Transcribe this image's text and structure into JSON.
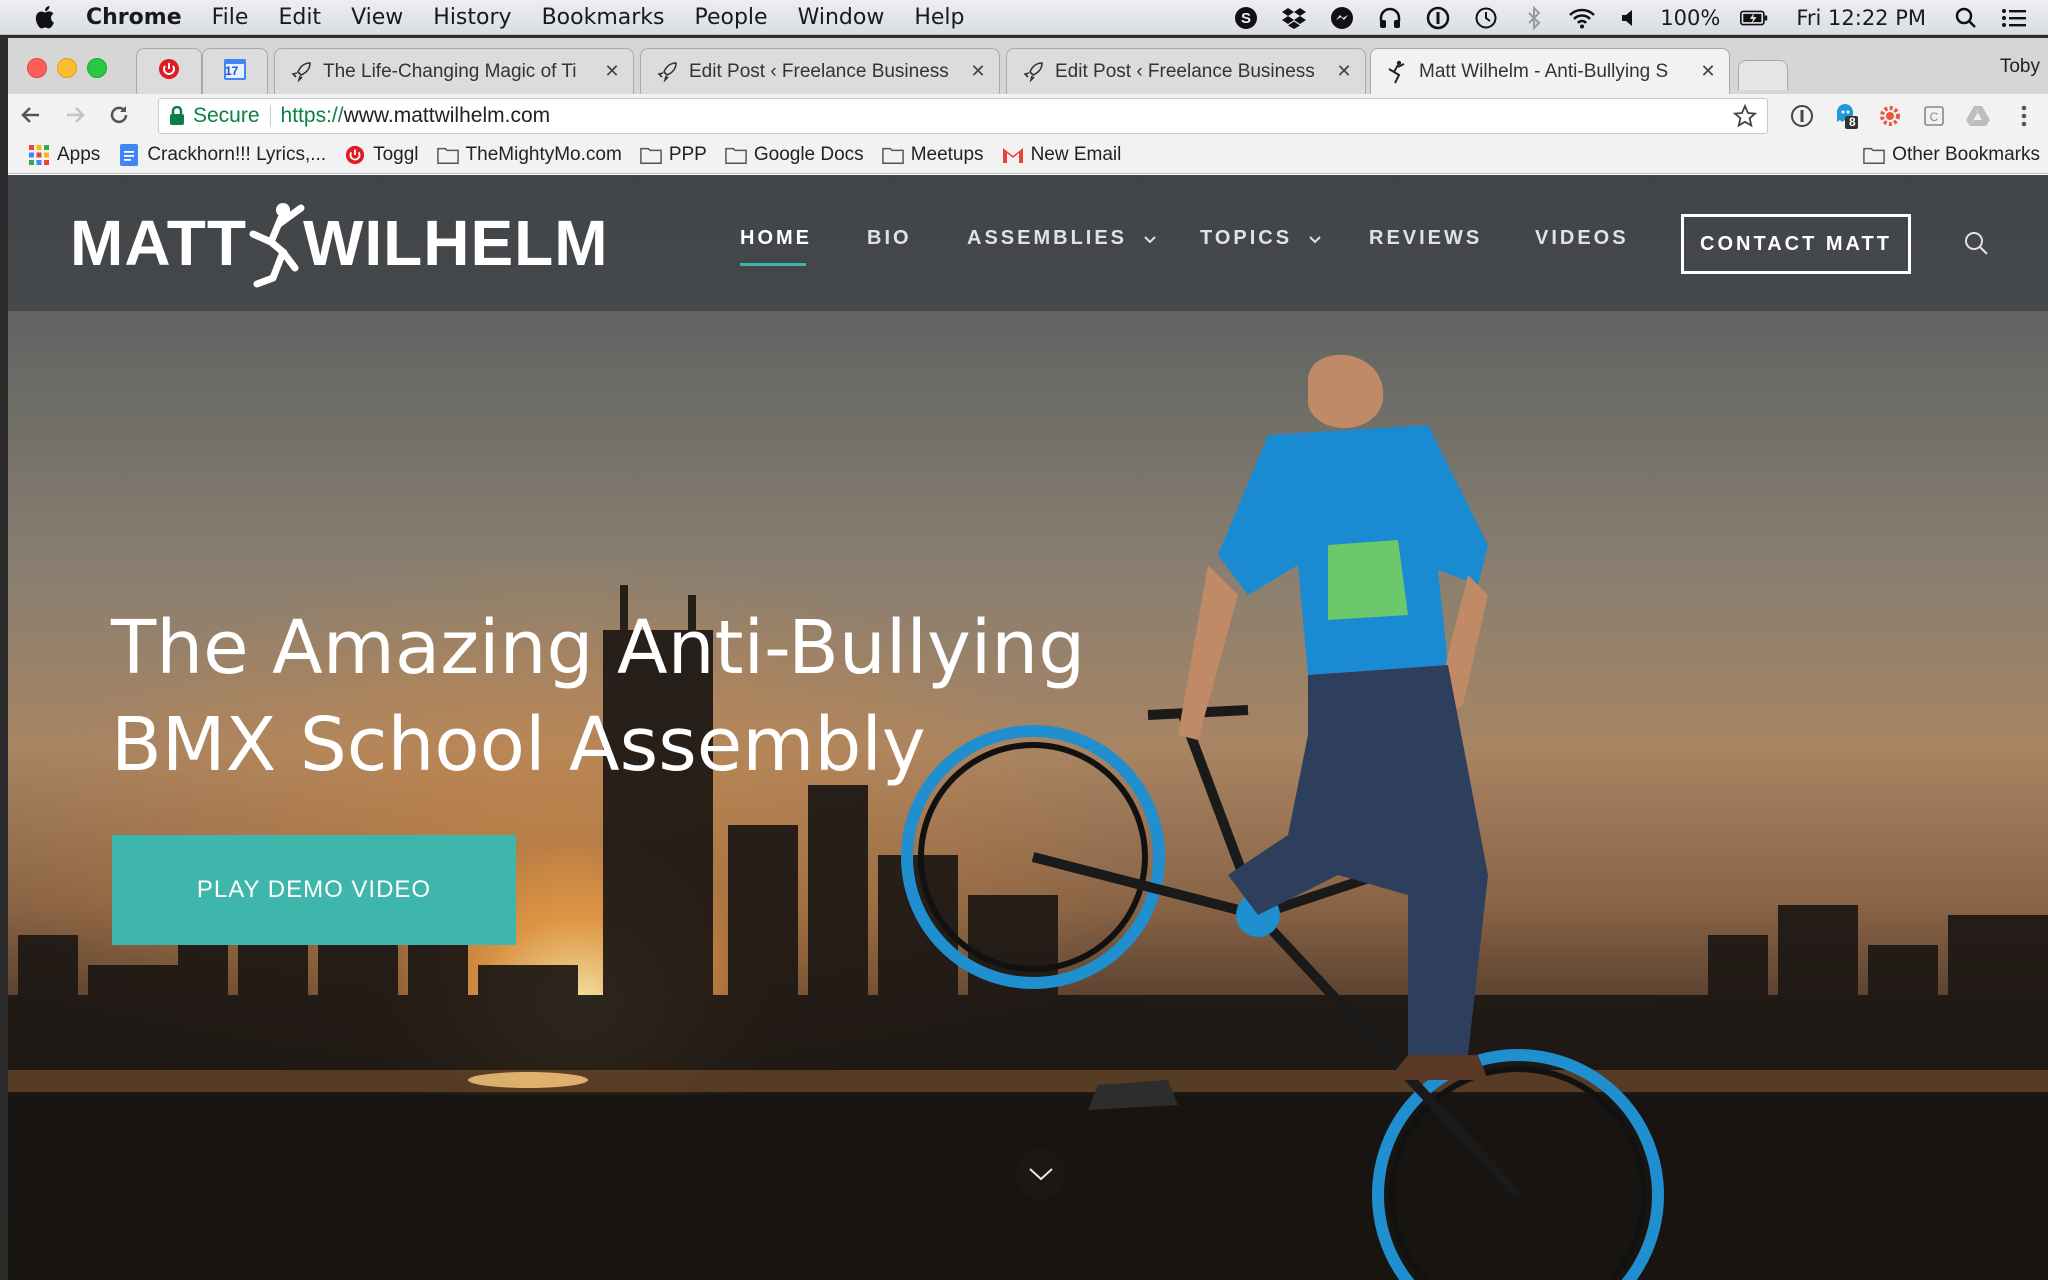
{
  "menubar": {
    "app": "Chrome",
    "items": [
      "File",
      "Edit",
      "View",
      "History",
      "Bookmarks",
      "People",
      "Window",
      "Help"
    ],
    "battery": "100%",
    "clock": "Fri 12:22 PM"
  },
  "browser": {
    "profile": "Toby",
    "tabs": [
      {
        "title": "The Life-Changing Magic of Ti",
        "icon": "rocket-icon"
      },
      {
        "title": "Edit Post ‹ Freelance Business",
        "icon": "rocket-icon"
      },
      {
        "title": "Edit Post ‹ Freelance Business",
        "icon": "rocket-icon"
      },
      {
        "title": "Matt Wilhelm - Anti-Bullying S",
        "icon": "bmx-rider-icon"
      }
    ],
    "pinned_tab_badge": "17",
    "security_label": "Secure",
    "url_scheme": "https://",
    "url_host": "www.mattwilhelm.com",
    "extension_badge": "8",
    "bookmarks": [
      {
        "label": "Apps",
        "icon": "apps-grid-icon"
      },
      {
        "label": "Crackhorn!!! Lyrics,...",
        "icon": "docs-icon"
      },
      {
        "label": "Toggl",
        "icon": "toggl-icon"
      },
      {
        "label": "TheMightyMo.com",
        "icon": "folder-icon"
      },
      {
        "label": "PPP",
        "icon": "folder-icon"
      },
      {
        "label": "Google Docs",
        "icon": "folder-icon"
      },
      {
        "label": "Meetups",
        "icon": "folder-icon"
      },
      {
        "label": "New Email",
        "icon": "gmail-icon"
      }
    ],
    "other_bookmarks": "Other Bookmarks"
  },
  "site": {
    "logo_left": "MATT",
    "logo_right": "WILHELM",
    "nav": {
      "home": "HOME",
      "bio": "BIO",
      "assemblies": "ASSEMBLIES",
      "topics": "TOPICS",
      "reviews": "REVIEWS",
      "videos": "VIDEOS"
    },
    "contact": "CONTACT MATT",
    "hero_line1": "The Amazing Anti-Bullying",
    "hero_line2": "BMX School Assembly",
    "cta": "PLAY DEMO VIDEO",
    "accent_color": "#3fb6ab"
  }
}
